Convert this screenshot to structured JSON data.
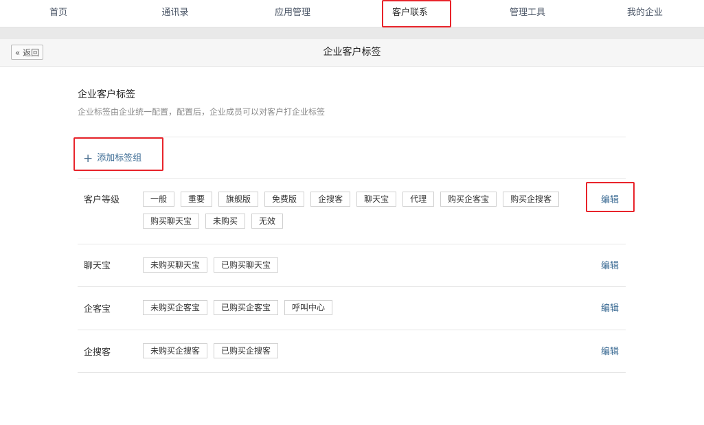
{
  "topnav": {
    "items": [
      {
        "label": "首页"
      },
      {
        "label": "通讯录"
      },
      {
        "label": "应用管理"
      },
      {
        "label": "客户联系"
      },
      {
        "label": "管理工具"
      },
      {
        "label": "我的企业"
      }
    ]
  },
  "titlebar": {
    "back_label": "« 返回",
    "title": "企业客户标签"
  },
  "section": {
    "title": "企业客户标签",
    "description": "企业标签由企业统一配置，配置后，企业成员可以对客户打企业标签",
    "add_group_label": "添加标签组"
  },
  "groups": [
    {
      "name": "客户等级",
      "tags": [
        "一般",
        "重要",
        "旗舰版",
        "免费版",
        "企搜客",
        "聊天宝",
        "代理",
        "购买企客宝",
        "购买企搜客",
        "购买聊天宝",
        "未购买",
        "无效"
      ],
      "edit_label": "编辑"
    },
    {
      "name": "聊天宝",
      "tags": [
        "未购买聊天宝",
        "已购买聊天宝"
      ],
      "edit_label": "编辑"
    },
    {
      "name": "企客宝",
      "tags": [
        "未购买企客宝",
        "已购买企客宝",
        "呼叫中心"
      ],
      "edit_label": "编辑"
    },
    {
      "name": "企搜客",
      "tags": [
        "未购买企搜客",
        "已购买企搜客"
      ],
      "edit_label": "编辑"
    }
  ],
  "colors": {
    "highlight_box": "#e8232a",
    "link": "#3a6a93"
  }
}
